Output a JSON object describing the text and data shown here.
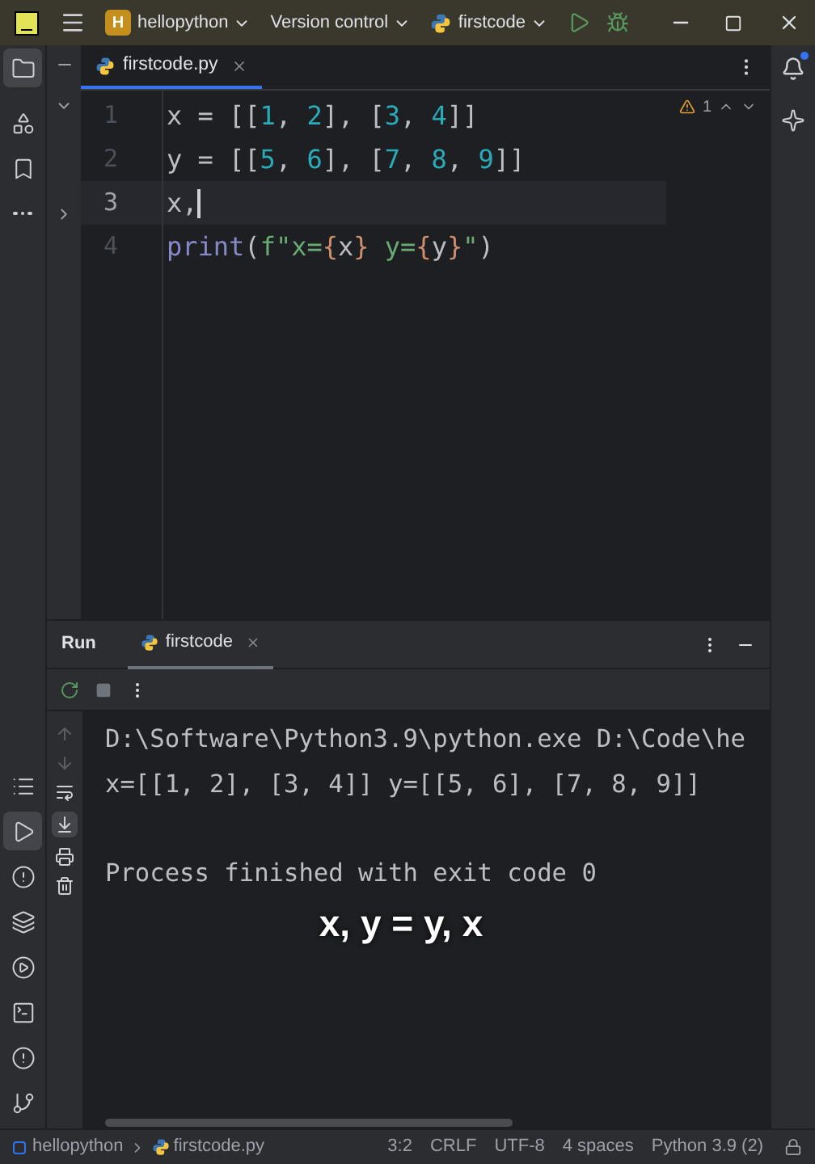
{
  "title_bar": {
    "project_badge": "H",
    "project": "hellopython",
    "vcs": "Version control",
    "run_config": "firstcode"
  },
  "editor": {
    "tabs": [
      {
        "label": "firstcode.py",
        "selected": true
      }
    ],
    "warnings": "1",
    "lines": [
      {
        "number": "1",
        "current": false,
        "tokens": [
          {
            "kind": "plain",
            "text": "x = [["
          },
          {
            "kind": "number",
            "text": "1"
          },
          {
            "kind": "plain",
            "text": ", "
          },
          {
            "kind": "number",
            "text": "2"
          },
          {
            "kind": "plain",
            "text": "], ["
          },
          {
            "kind": "number",
            "text": "3"
          },
          {
            "kind": "plain",
            "text": ", "
          },
          {
            "kind": "number",
            "text": "4"
          },
          {
            "kind": "plain",
            "text": "]]"
          }
        ]
      },
      {
        "number": "2",
        "current": false,
        "tokens": [
          {
            "kind": "plain",
            "text": "y = [["
          },
          {
            "kind": "number",
            "text": "5"
          },
          {
            "kind": "plain",
            "text": ", "
          },
          {
            "kind": "number",
            "text": "6"
          },
          {
            "kind": "plain",
            "text": "], ["
          },
          {
            "kind": "number",
            "text": "7"
          },
          {
            "kind": "plain",
            "text": ", "
          },
          {
            "kind": "number",
            "text": "8"
          },
          {
            "kind": "plain",
            "text": ", "
          },
          {
            "kind": "number",
            "text": "9"
          },
          {
            "kind": "plain",
            "text": "]]"
          }
        ]
      },
      {
        "number": "3",
        "current": true,
        "tokens": [
          {
            "kind": "plain",
            "text": "x,"
          }
        ]
      },
      {
        "number": "4",
        "current": false,
        "tokens": [
          {
            "kind": "builtin",
            "text": "print"
          },
          {
            "kind": "plain",
            "text": "("
          },
          {
            "kind": "string",
            "text": "f\"x="
          },
          {
            "kind": "brace",
            "text": "{"
          },
          {
            "kind": "plain",
            "text": "x"
          },
          {
            "kind": "brace",
            "text": "}"
          },
          {
            "kind": "string",
            "text": " y="
          },
          {
            "kind": "brace",
            "text": "{"
          },
          {
            "kind": "plain",
            "text": "y"
          },
          {
            "kind": "brace",
            "text": "}"
          },
          {
            "kind": "string",
            "text": "\""
          },
          {
            "kind": "plain",
            "text": ")"
          }
        ]
      }
    ]
  },
  "run_panel": {
    "title": "Run",
    "tabs": [
      {
        "label": "firstcode",
        "selected": true
      }
    ],
    "output": [
      {
        "kind": "command",
        "text": "D:\\Software\\Python3.9\\python.exe D:\\Code\\he"
      },
      {
        "kind": "output",
        "text": "x=[[1, 2], [3, 4]] y=[[5, 6], [7, 8, 9]]"
      },
      {
        "kind": "exit",
        "text": "Process finished with exit code 0"
      }
    ],
    "caption": "x, y = y, x"
  },
  "status_bar": {
    "breadcrumbs": [
      "hellopython",
      "firstcode.py"
    ],
    "items": [
      "3:2",
      "CRLF",
      "UTF-8",
      "4 spaces",
      "Python 3.9 (2)"
    ]
  }
}
